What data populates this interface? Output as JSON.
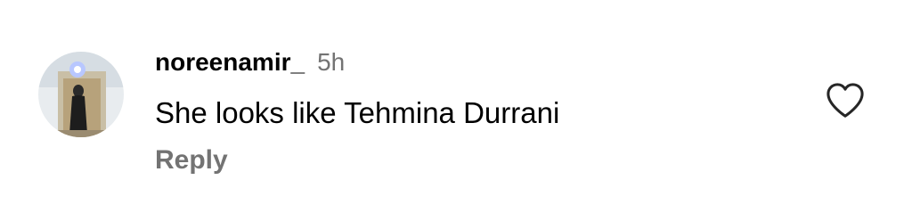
{
  "comment": {
    "avatar_icon": "profile-photo-avatar",
    "username": "noreenamir_",
    "timestamp": "5h",
    "text": "She looks like Tehmina Durrani",
    "reply_label": "Reply",
    "like_icon": "heart-outline-icon"
  },
  "colors": {
    "text_primary": "#000000",
    "text_secondary": "#737373",
    "background": "#ffffff",
    "icon_stroke": "#262626"
  }
}
